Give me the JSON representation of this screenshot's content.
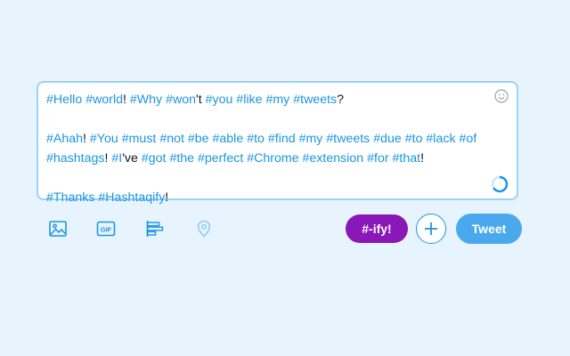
{
  "compose": {
    "paragraphs": [
      [
        {
          "t": "#Hello",
          "tag": true
        },
        {
          "t": " ",
          "tag": false
        },
        {
          "t": "#world",
          "tag": true
        },
        {
          "t": "! ",
          "tag": false
        },
        {
          "t": "#Why",
          "tag": true
        },
        {
          "t": " ",
          "tag": false
        },
        {
          "t": "#won",
          "tag": true
        },
        {
          "t": "'t ",
          "tag": false
        },
        {
          "t": "#you",
          "tag": true
        },
        {
          "t": " ",
          "tag": false
        },
        {
          "t": "#like",
          "tag": true
        },
        {
          "t": " ",
          "tag": false
        },
        {
          "t": "#my",
          "tag": true
        },
        {
          "t": " ",
          "tag": false
        },
        {
          "t": "#tweets",
          "tag": true
        },
        {
          "t": "?",
          "tag": false
        }
      ],
      [],
      [
        {
          "t": "#Ahah",
          "tag": true
        },
        {
          "t": "! ",
          "tag": false
        },
        {
          "t": "#You",
          "tag": true
        },
        {
          "t": " ",
          "tag": false
        },
        {
          "t": "#must",
          "tag": true
        },
        {
          "t": " ",
          "tag": false
        },
        {
          "t": "#not",
          "tag": true
        },
        {
          "t": " ",
          "tag": false
        },
        {
          "t": "#be",
          "tag": true
        },
        {
          "t": " ",
          "tag": false
        },
        {
          "t": "#able",
          "tag": true
        },
        {
          "t": " ",
          "tag": false
        },
        {
          "t": "#to",
          "tag": true
        },
        {
          "t": " ",
          "tag": false
        },
        {
          "t": "#find",
          "tag": true
        },
        {
          "t": " ",
          "tag": false
        },
        {
          "t": "#my",
          "tag": true
        },
        {
          "t": " ",
          "tag": false
        },
        {
          "t": "#tweets",
          "tag": true
        },
        {
          "t": " ",
          "tag": false
        },
        {
          "t": "#due",
          "tag": true
        },
        {
          "t": " ",
          "tag": false
        },
        {
          "t": "#to",
          "tag": true
        },
        {
          "t": " ",
          "tag": false
        },
        {
          "t": "#lack",
          "tag": true
        },
        {
          "t": " ",
          "tag": false
        },
        {
          "t": "#of",
          "tag": true
        },
        {
          "t": " ",
          "tag": false
        },
        {
          "t": "#hashtags",
          "tag": true
        },
        {
          "t": "! ",
          "tag": false
        },
        {
          "t": "#I",
          "tag": true
        },
        {
          "t": "'ve ",
          "tag": false
        },
        {
          "t": "#got",
          "tag": true
        },
        {
          "t": " ",
          "tag": false
        },
        {
          "t": "#the",
          "tag": true
        },
        {
          "t": " ",
          "tag": false
        },
        {
          "t": "#perfect",
          "tag": true
        },
        {
          "t": " ",
          "tag": false
        },
        {
          "t": "#Chrome",
          "tag": true
        },
        {
          "t": " ",
          "tag": false
        },
        {
          "t": "#extension",
          "tag": true
        },
        {
          "t": " ",
          "tag": false
        },
        {
          "t": "#for",
          "tag": true
        },
        {
          "t": " ",
          "tag": false
        },
        {
          "t": "#that",
          "tag": true
        },
        {
          "t": "!",
          "tag": false
        }
      ],
      [],
      [
        {
          "t": "#Thanks",
          "tag": true
        },
        {
          "t": " ",
          "tag": false
        },
        {
          "t": "#Hashtaqify",
          "tag": true
        },
        {
          "t": "!",
          "tag": false
        }
      ]
    ]
  },
  "toolbar": {
    "gif_label": "GIF",
    "ify_label": "#-ify!",
    "tweet_label": "Tweet"
  },
  "colors": {
    "hashtag": "#1b95e0",
    "ify_button": "#8a17b8",
    "tweet_button": "#4aa9ec",
    "background": "#e8f4fd"
  },
  "icons": [
    "smiley-icon",
    "char-counter-icon",
    "image-icon",
    "gif-icon",
    "poll-icon",
    "location-icon",
    "plus-icon"
  ]
}
